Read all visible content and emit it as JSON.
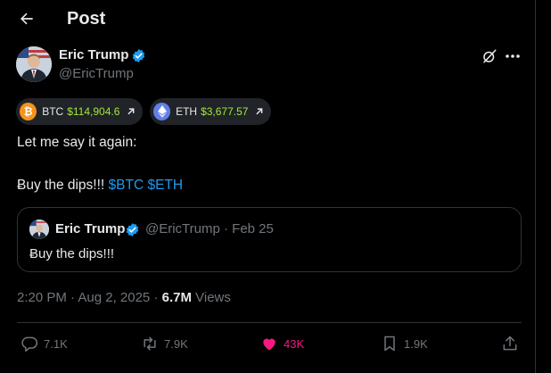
{
  "header": {
    "title": "Post",
    "back_icon": "arrow-left-icon"
  },
  "author": {
    "name": "Eric Trump",
    "handle": "@EricTrump",
    "verified": true
  },
  "icons": {
    "grok": "grok-slash-icon",
    "more": "more-dots-icon"
  },
  "tickers": [
    {
      "symbol": "BTC",
      "price": "$114,904.6",
      "coin_color": "#f7931a",
      "icon": "bitcoin-icon"
    },
    {
      "symbol": "ETH",
      "price": "$3,677.57",
      "coin_color": "#627eea",
      "icon": "ethereum-icon"
    }
  ],
  "post": {
    "line1": "Let me say it again:",
    "line2_prefix": "Ƀuy the dips!!!",
    "cashtag_btc": "$BTC",
    "cashtag_eth": "$ETH"
  },
  "quote": {
    "name": "Eric Trump",
    "meta": "@EricTrump · Feb 25",
    "text": "Ƀuy the dips!!!"
  },
  "meta": {
    "timestamp": "2:20 PM · Aug 2, 2025 · ",
    "views_count": "6.7M",
    "views_label": " Views"
  },
  "actions": {
    "replies": "7.1K",
    "reposts": "7.9K",
    "likes": "43K",
    "bookmarks": "1.9K"
  },
  "colors": {
    "accent": "#1d9bf0",
    "like": "#f91880",
    "price_up": "#a0e83d"
  }
}
